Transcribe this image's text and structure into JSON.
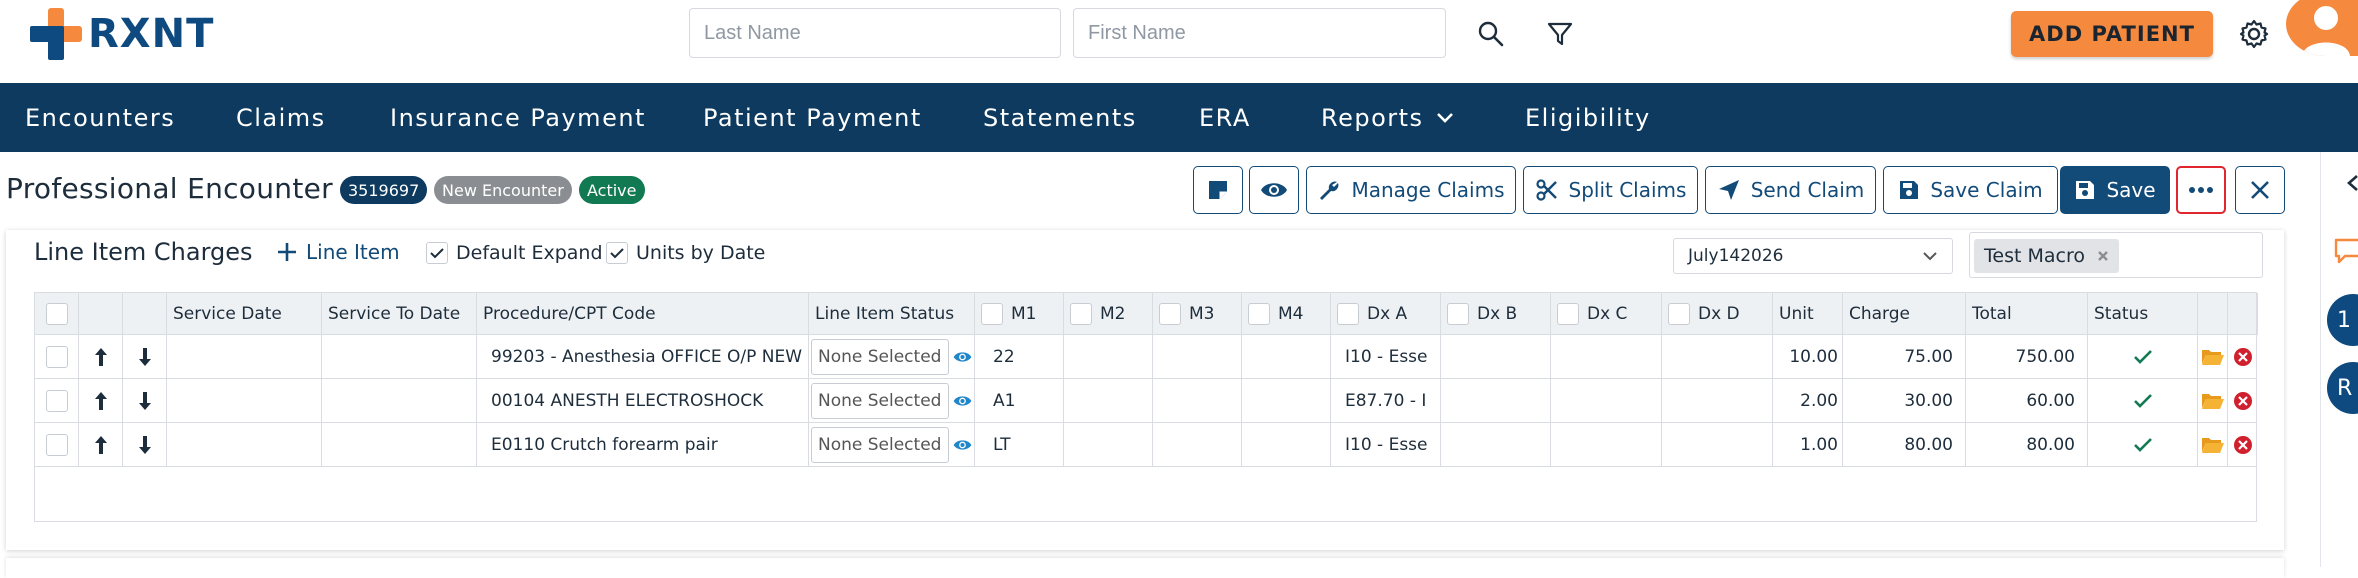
{
  "app": {
    "brand": "RXNT"
  },
  "header": {
    "last_name_placeholder": "Last Name",
    "first_name_placeholder": "First Name",
    "add_patient_label": "ADD PATIENT"
  },
  "nav": {
    "items": [
      "Encounters",
      "Claims",
      "Insurance Payment",
      "Patient Payment",
      "Statements",
      "ERA",
      "Reports",
      "Eligibility"
    ]
  },
  "page": {
    "title": "Professional Encounter",
    "encounter_id": "3519697",
    "badge_new": "New Encounter",
    "badge_status": "Active",
    "badge_colors": {
      "id": "#0d3a5e",
      "new": "#8a8d91",
      "active": "#127a52"
    }
  },
  "toolbar": {
    "manage_claims": "Manage Claims",
    "split_claims": "Split Claims",
    "send_claim": "Send Claim",
    "save_claim": "Save Claim",
    "save": "Save",
    "more": "..."
  },
  "right_strip": {
    "circle_1": "1",
    "circle_2": "R"
  },
  "line_items": {
    "title": "Line Item Charges",
    "add_label": "Line Item",
    "default_expand_label": "Default Expand",
    "units_by_date_label": "Units by Date",
    "macro_select_value": "July142026",
    "macro_tag": "Test Macro",
    "columns": [
      "Service Date",
      "Service To Date",
      "Procedure/CPT Code",
      "Line Item Status",
      "M1",
      "M2",
      "M3",
      "M4",
      "Dx A",
      "Dx B",
      "Dx C",
      "Dx D",
      "Unit",
      "Charge",
      "Total",
      "Status"
    ],
    "rows": [
      {
        "procedure": "99203 - Anesthesia OFFICE O/P NEW",
        "status": "None Selected",
        "m1": "22",
        "dx_a": "I10 - Esse",
        "unit": "10.00",
        "charge": "75.00",
        "total": "750.00"
      },
      {
        "procedure": "00104 ANESTH ELECTROSHOCK",
        "status": "None Selected",
        "m1": "A1",
        "dx_a": "E87.70 - I",
        "unit": "2.00",
        "charge": "30.00",
        "total": "60.00"
      },
      {
        "procedure": "E0110 Crutch forearm pair",
        "status": "None Selected",
        "m1": "LT",
        "dx_a": "I10 - Esse",
        "unit": "1.00",
        "charge": "80.00",
        "total": "80.00"
      }
    ]
  },
  "colors": {
    "brand": "#0e4a80",
    "nav_bg": "#0d3a5e",
    "accent": "#f58a3e",
    "success": "#127a52",
    "danger": "#d0202e"
  }
}
